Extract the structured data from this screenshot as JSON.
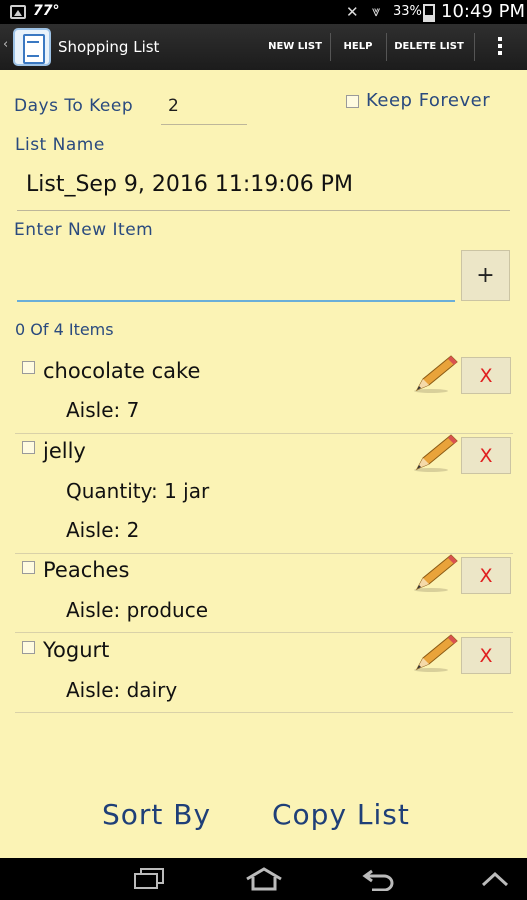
{
  "status_bar": {
    "temperature": "77°",
    "battery_percent": "33%",
    "time": "10:49 PM"
  },
  "action_bar": {
    "title": "Shopping List",
    "new_list": "NEW LIST",
    "help": "HELP",
    "delete_list": "DELETE LIST"
  },
  "form": {
    "days_to_keep_label": "Days To Keep",
    "days_to_keep_value": "2",
    "keep_forever_label": "Keep Forever",
    "list_name_label": "List Name",
    "list_name_value": "List_Sep 9, 2016 11:19:06 PM",
    "enter_new_item_label": "Enter New Item",
    "add_button": "+"
  },
  "summary": {
    "count_text": "0 Of 4 Items"
  },
  "items": [
    {
      "name": "chocolate cake",
      "details": [
        "Aisle: 7"
      ]
    },
    {
      "name": "jelly",
      "details": [
        "Quantity: 1 jar",
        "Aisle: 2"
      ]
    },
    {
      "name": "Peaches",
      "details": [
        "Aisle: produce"
      ]
    },
    {
      "name": "Yogurt",
      "details": [
        "Aisle: dairy"
      ]
    }
  ],
  "delete_label": "X",
  "bottom": {
    "sort_by": "Sort By",
    "copy_list": "Copy List"
  },
  "colors": {
    "background": "#fbf3b5",
    "label_blue": "#2a4a7e",
    "delete_red": "#e02020",
    "input_underline": "#6aaed8"
  }
}
